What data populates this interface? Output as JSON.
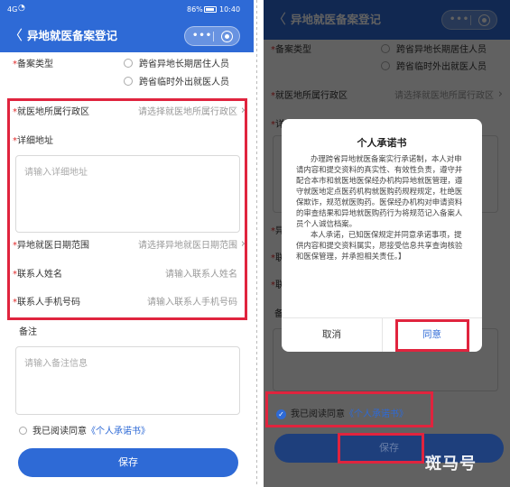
{
  "status": {
    "signal": "4G",
    "battery_percent": "86%",
    "time": "10:40"
  },
  "nav": {
    "back_glyph": "〈",
    "title": "异地就医备案登记",
    "dots": "•••"
  },
  "form": {
    "type_label": "备案类型",
    "type_options": [
      "跨省异地长期居住人员",
      "跨省临时外出就医人员"
    ],
    "region_label": "就医地所属行政区",
    "region_placeholder": "请选择就医地所属行政区",
    "address_label": "详细地址",
    "address_placeholder": "请输入详细地址",
    "date_label": "异地就医日期范围",
    "date_placeholder": "请选择异地就医日期范围",
    "contact_name_label": "联系人姓名",
    "contact_name_placeholder": "请输入联系人姓名",
    "contact_phone_label": "联系人手机号码",
    "contact_phone_placeholder": "请输入联系人手机号码",
    "remarks_label": "备注",
    "remarks_placeholder": "请输入备注信息",
    "agree_prefix": "我已阅读同意",
    "agree_link": "《个人承诺书》",
    "save_label": "保存",
    "chevron": "›",
    "required_mark": "*"
  },
  "dialog": {
    "title": "个人承诺书",
    "paragraph1": "办理跨省异地就医备案实行承诺制，本人对申请内容和提交资料的真实性、有效性负责，遵守并配合本市和就医地医保经办机构异地就医管理，遵守就医地定点医药机构就医购药规程规定，杜绝医保欺诈，规范就医购药。医保经办机构对申请资料的审查结果和异地就医购药行为将规范记入备案人员个人诚信档案。",
    "paragraph2": "本人承诺，已知医保规定并同意承诺事项，提供内容和提交资料属实，愿接受信息共享查询核验和医保管理，并承担相关责任。】",
    "cancel_label": "取消",
    "confirm_label": "同意"
  },
  "watermark": "斑马号",
  "colors": {
    "primary": "#2e6ad6",
    "highlight": "#e0243e",
    "required": "#e02a2a"
  }
}
